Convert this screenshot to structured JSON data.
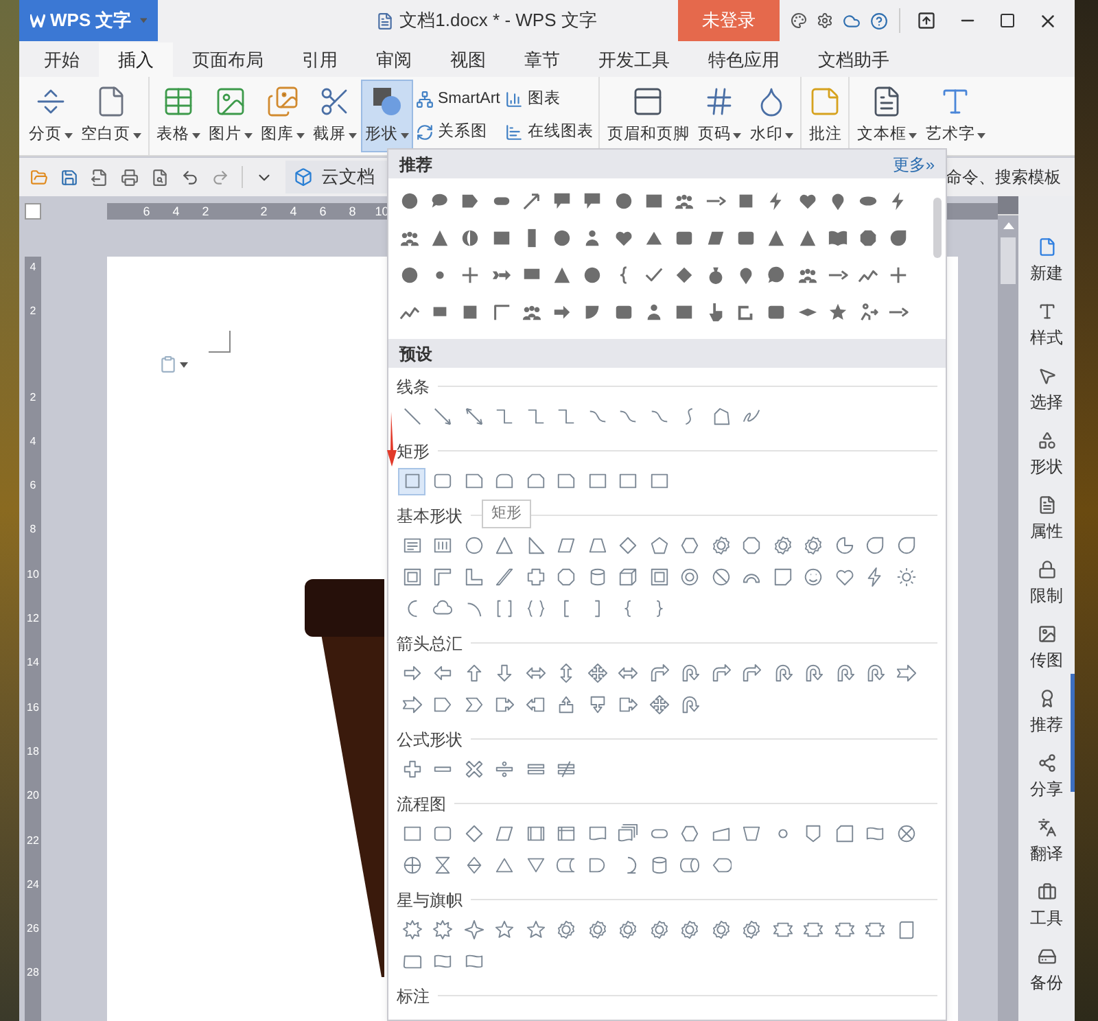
{
  "app_button": {
    "label": "WPS 文字"
  },
  "window": {
    "title": "文档1.docx * - WPS 文字"
  },
  "login_button": {
    "label": "未登录"
  },
  "tabs": [
    {
      "label": "开始",
      "selected": false
    },
    {
      "label": "插入",
      "selected": true
    },
    {
      "label": "页面布局",
      "selected": false
    },
    {
      "label": "引用",
      "selected": false
    },
    {
      "label": "审阅",
      "selected": false
    },
    {
      "label": "视图",
      "selected": false
    },
    {
      "label": "章节",
      "selected": false
    },
    {
      "label": "开发工具",
      "selected": false
    },
    {
      "label": "特色应用",
      "selected": false
    },
    {
      "label": "文档助手",
      "selected": false
    }
  ],
  "ribbon": {
    "groups": [
      {
        "items": [
          {
            "kind": "large",
            "label": "分页",
            "dropdown": true,
            "selected": false
          },
          {
            "kind": "large",
            "label": "空白页",
            "dropdown": true,
            "selected": false
          }
        ]
      },
      {
        "items": [
          {
            "kind": "large",
            "label": "表格",
            "dropdown": true,
            "selected": false
          },
          {
            "kind": "large",
            "label": "图片",
            "dropdown": true,
            "selected": false
          },
          {
            "kind": "large",
            "label": "图库",
            "dropdown": true,
            "selected": false
          },
          {
            "kind": "large",
            "label": "截屏",
            "dropdown": true,
            "selected": false
          },
          {
            "kind": "large",
            "label": "形状",
            "dropdown": true,
            "selected": true
          },
          {
            "kind": "stack",
            "items": [
              {
                "label": "SmartArt"
              },
              {
                "label": "关系图"
              }
            ]
          },
          {
            "kind": "stack",
            "items": [
              {
                "label": "图表"
              },
              {
                "label": "在线图表"
              }
            ]
          }
        ]
      },
      {
        "items": [
          {
            "kind": "large",
            "label": "页眉和页脚",
            "dropdown": false,
            "selected": false
          },
          {
            "kind": "large",
            "label": "页码",
            "dropdown": true,
            "selected": false
          },
          {
            "kind": "large",
            "label": "水印",
            "dropdown": true,
            "selected": false
          }
        ]
      },
      {
        "items": [
          {
            "kind": "large",
            "label": "批注",
            "dropdown": false,
            "selected": false
          }
        ]
      },
      {
        "items": [
          {
            "kind": "large",
            "label": "文本框",
            "dropdown": true,
            "selected": false
          },
          {
            "kind": "large",
            "label": "艺术字",
            "dropdown": true,
            "selected": false
          }
        ]
      }
    ]
  },
  "quick_access": {
    "tab": {
      "label": "云文档"
    },
    "search_hint": "命令、搜索模板"
  },
  "ruler": {
    "horizontal": [
      "6",
      "4",
      "2",
      "2",
      "4",
      "6",
      "8",
      "10"
    ],
    "vertical": [
      "4",
      "2",
      "2",
      "4",
      "6",
      "8",
      "10",
      "12",
      "14",
      "16",
      "18",
      "20",
      "22",
      "24",
      "26",
      "28"
    ]
  },
  "shape_panel": {
    "recommended": {
      "title": "推荐",
      "more": "更多»"
    },
    "preset": {
      "title": "预设",
      "sections": [
        {
          "title": "线条"
        },
        {
          "title": "矩形",
          "tooltip": "矩形"
        },
        {
          "title": "基本形状"
        },
        {
          "title": "箭头总汇"
        },
        {
          "title": "公式形状"
        },
        {
          "title": "流程图"
        },
        {
          "title": "星与旗帜"
        },
        {
          "title": "标注"
        }
      ]
    }
  },
  "sidebar": {
    "items": [
      {
        "label": "新建"
      },
      {
        "label": "样式"
      },
      {
        "label": "选择"
      },
      {
        "label": "形状"
      },
      {
        "label": "属性"
      },
      {
        "label": "限制"
      },
      {
        "label": "传图"
      },
      {
        "label": "推荐"
      },
      {
        "label": "分享"
      },
      {
        "label": "翻译"
      },
      {
        "label": "工具"
      },
      {
        "label": "备份"
      }
    ]
  }
}
